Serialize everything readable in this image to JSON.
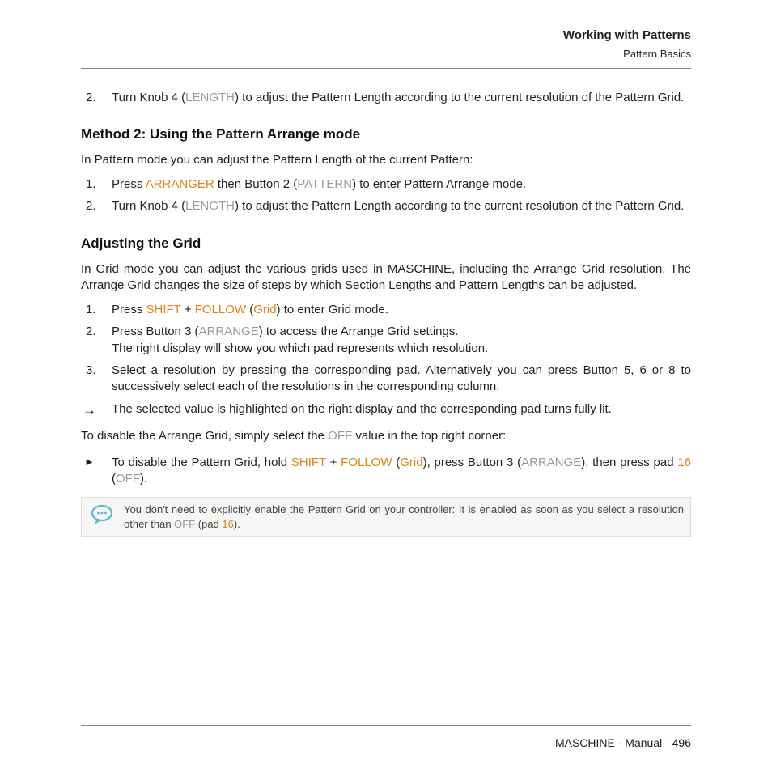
{
  "header": {
    "title": "Working with Patterns",
    "subtitle": "Pattern Basics"
  },
  "top_steps": [
    {
      "num": "2.",
      "pre": "Turn Knob 4 (",
      "gray1": "LENGTH",
      "post": ") to adjust the Pattern Length according to the current resolution of the Pattern Grid."
    }
  ],
  "method2": {
    "heading": "Method 2: Using the Pattern Arrange mode",
    "intro": "In Pattern mode you can adjust the Pattern Length of the current Pattern:",
    "step1": {
      "num": "1.",
      "t1": "Press ",
      "kw1": "ARRANGER",
      "t2": " then Button 2 (",
      "gray1": "PATTERN",
      "t3": ") to enter Pattern Arrange mode."
    },
    "step2": {
      "num": "2.",
      "t1": "Turn Knob 4 (",
      "gray1": "LENGTH",
      "t2": ") to adjust the Pattern Length according to the current resolution of the Pattern Grid."
    }
  },
  "grid": {
    "heading": "Adjusting the Grid",
    "intro": "In Grid mode you can adjust the various grids used in MASCHINE, including the Arrange Grid resolution. The Arrange Grid changes the size of steps by which Section Lengths and Pattern Lengths can be adjusted.",
    "step1": {
      "num": "1.",
      "t1": "Press ",
      "kw1": "SHIFT",
      "t2": " + ",
      "kw2": "FOLLOW",
      "t3": " (",
      "kw3": "Grid",
      "t4": ") to enter Grid mode."
    },
    "step2": {
      "num": "2.",
      "t1": "Press Button 3 (",
      "gray1": "ARRANGE",
      "t2": ") to access the Arrange Grid settings.",
      "br": "The right display will show you which pad represents which resolution."
    },
    "step3": {
      "num": "3.",
      "t1": "Select a resolution by pressing the corresponding pad. Alternatively you can press Button 5, 6 or 8 to successively select each of the resolutions in the corresponding column."
    },
    "arrow": {
      "mark": "→",
      "t1": "The selected value is highlighted on the right display and the corresponding pad turns fully lit."
    },
    "disable_line": {
      "t1": "To disable the Arrange Grid, simply select the ",
      "gray1": "OFF",
      "t2": " value in the top right corner:"
    },
    "tri": {
      "mark": "►",
      "t1": "To disable the Pattern Grid, hold ",
      "kw1": "SHIFT",
      "t2": " + ",
      "kw2": "FOLLOW",
      "t3": " (",
      "kw3": "Grid",
      "t4": "), press Button 3 (",
      "gray1": "ARRANGE",
      "t5": "), then press pad ",
      "kw4": "16",
      "t6": " (",
      "gray2": "OFF",
      "t7": ")."
    }
  },
  "tip": {
    "t1": "You don't need to explicitly enable the Pattern Grid on your controller: It is enabled as soon as you select a resolution other than ",
    "gray1": "OFF",
    "t2": " (pad ",
    "kw1": "16",
    "t3": ")."
  },
  "footer": {
    "text": "MASCHINE - Manual - 496"
  }
}
